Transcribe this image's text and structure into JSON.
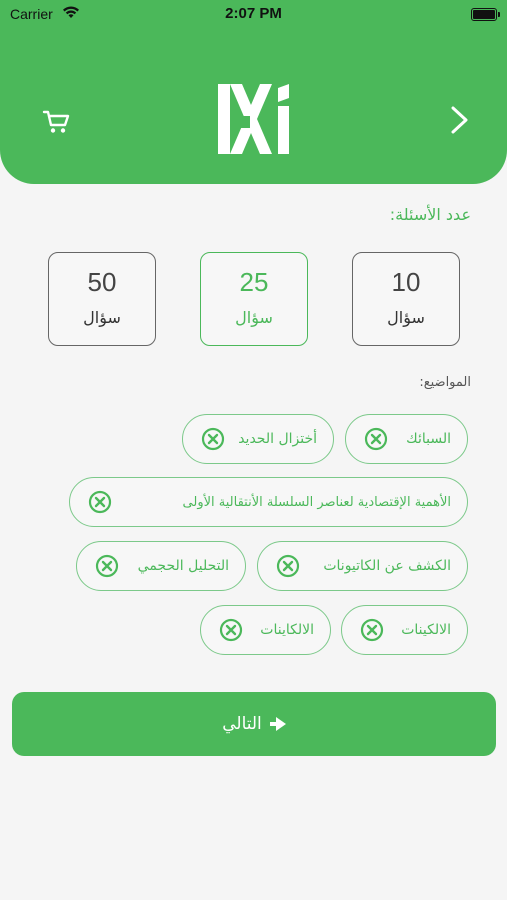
{
  "status_bar": {
    "carrier": "Carrier",
    "time": "2:07 PM"
  },
  "header": {
    "logo_text": "Xi"
  },
  "count_section": {
    "label": "عدد الأسئلة:",
    "options": [
      {
        "value": "10",
        "unit": "سؤال",
        "selected": false
      },
      {
        "value": "25",
        "unit": "سؤال",
        "selected": true
      },
      {
        "value": "50",
        "unit": "سؤال",
        "selected": false
      }
    ]
  },
  "topics_section": {
    "label": "المواضيع:",
    "chips": [
      {
        "label": "السبائك"
      },
      {
        "label": "أختزال الحديد"
      },
      {
        "label": "الأهمية الإقتصادية لعناصر السلسلة الأنتقالية الأولى"
      },
      {
        "label": "الكشف عن الكاتيونات"
      },
      {
        "label": "التحليل الحجمي"
      },
      {
        "label": "الالكينات"
      },
      {
        "label": "الالكاينات"
      }
    ]
  },
  "next_button": {
    "label": "التالي"
  },
  "colors": {
    "primary": "#4bb85a",
    "background": "#f5f5f5"
  }
}
